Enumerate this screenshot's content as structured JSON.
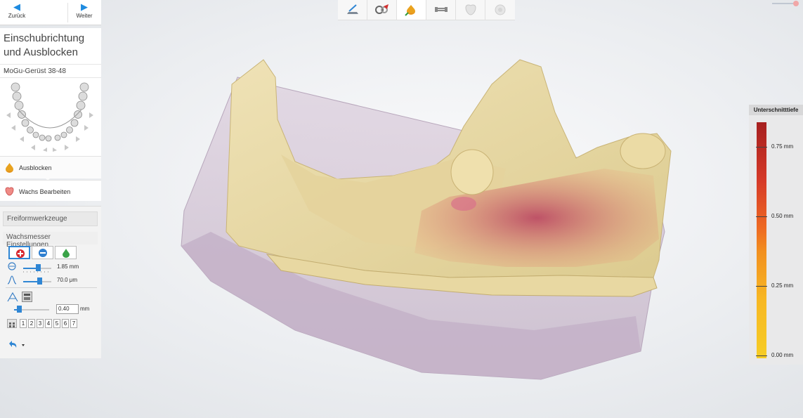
{
  "nav": {
    "back_label": "Zurück",
    "next_label": "Weiter"
  },
  "step": {
    "title": "Einschubrichtung und Ausblocken",
    "case_name": "MoGu-Gerüst 38-48"
  },
  "modes": [
    {
      "label": "Ausblocken",
      "icon": "wax-drop-icon"
    },
    {
      "label": "Wachs Bearbeiten",
      "icon": "wax-tooth-icon"
    }
  ],
  "tools": {
    "freiform_label": "Freiformwerkzeuge",
    "wachsmesser_label": "Wachsmesser Einstellungen",
    "buttons": [
      "add-wax-icon",
      "remove-wax-icon",
      "smooth-wax-icon"
    ],
    "size": {
      "value": 1.85,
      "text": "1.85 mm"
    },
    "angle": {
      "value": 70.0,
      "text": "70.0 μm"
    },
    "depth": {
      "value": "0.40",
      "unit": "mm"
    },
    "presets": [
      "1",
      "2",
      "3",
      "4",
      "5",
      "6",
      "7"
    ]
  },
  "toolbar": {
    "items": [
      "scan-preparation-icon",
      "design-tools-icon",
      "blockout-icon",
      "framework-icon",
      "tooth-shape-icon",
      "finalize-icon"
    ],
    "active_index": 2
  },
  "legend": {
    "title": "Unterschnitttiefe",
    "labels": [
      "0.75 mm",
      "0.50 mm",
      "0.25 mm",
      "0.00 mm"
    ],
    "colors": [
      "#a62020",
      "#d63a28",
      "#ee6a22",
      "#f2901f",
      "#f7b723",
      "#f6cd25"
    ]
  },
  "model": {
    "base_color": "#e9d9a7",
    "undercut_color": "#c94a6a",
    "socket_color": "#c9b8cc"
  }
}
